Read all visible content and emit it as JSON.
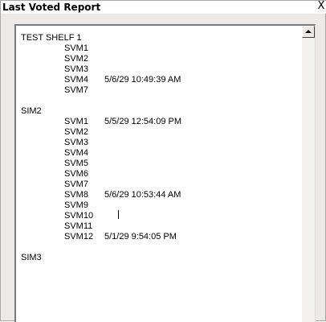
{
  "window": {
    "title": "Last Voted Report",
    "close_label": "X"
  },
  "report": {
    "groups": [
      {
        "name": "TEST SHELF 1",
        "rows": [
          {
            "name": "SVM1",
            "time": ""
          },
          {
            "name": "SVM2",
            "time": ""
          },
          {
            "name": "SVM3",
            "time": ""
          },
          {
            "name": "SVM4",
            "time": "5/6/29 10:49:39 AM"
          },
          {
            "name": "SVM7",
            "time": ""
          }
        ]
      },
      {
        "name": "SIM2",
        "rows": [
          {
            "name": "SVM1",
            "time": "5/5/29 12:54:09 PM"
          },
          {
            "name": "SVM2",
            "time": ""
          },
          {
            "name": "SVM3",
            "time": ""
          },
          {
            "name": "SVM4",
            "time": ""
          },
          {
            "name": "SVM5",
            "time": ""
          },
          {
            "name": "SVM6",
            "time": ""
          },
          {
            "name": "SVM7",
            "time": ""
          },
          {
            "name": "SVM8",
            "time": "5/6/29 10:53:44 AM"
          },
          {
            "name": "SVM9",
            "time": ""
          },
          {
            "name": "SVM10",
            "time": ""
          },
          {
            "name": "SVM11",
            "time": ""
          },
          {
            "name": "SVM12",
            "time": "5/1/29  9:54:05 PM"
          }
        ]
      },
      {
        "name": "SIM3",
        "rows": []
      }
    ]
  }
}
